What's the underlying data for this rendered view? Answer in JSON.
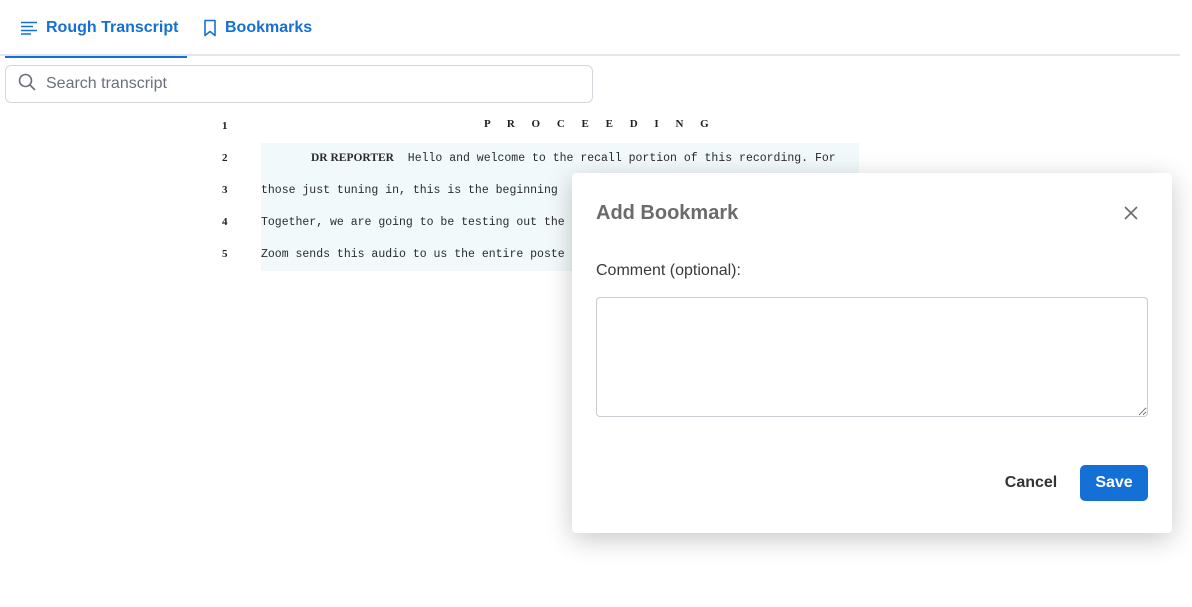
{
  "tabs": [
    {
      "label": "Rough Transcript",
      "icon": "lines-icon",
      "active": true
    },
    {
      "label": "Bookmarks",
      "icon": "bookmark-icon",
      "active": false
    }
  ],
  "search": {
    "placeholder": "Search transcript",
    "value": ""
  },
  "transcript": {
    "heading": "P R O C E E D I N G",
    "line_numbers": [
      "1",
      "2",
      "3",
      "4",
      "5"
    ],
    "lines": [
      {
        "speaker": "DR REPORTER",
        "text": "  Hello and welcome to the recall portion of this recording. For"
      },
      {
        "speaker": "",
        "text": "those just tuning in, this is the beginning"
      },
      {
        "speaker": "",
        "text": "Together, we are going to be testing out the"
      },
      {
        "speaker": "",
        "text": "Zoom sends this audio to us the entire poste"
      }
    ]
  },
  "modal": {
    "title": "Add Bookmark",
    "comment_label": "Comment (optional):",
    "comment_value": "",
    "cancel_label": "Cancel",
    "save_label": "Save"
  },
  "colors": {
    "accent": "#1570d6",
    "highlight": "#f1f9fb",
    "title_gray": "#6b6b6b"
  }
}
